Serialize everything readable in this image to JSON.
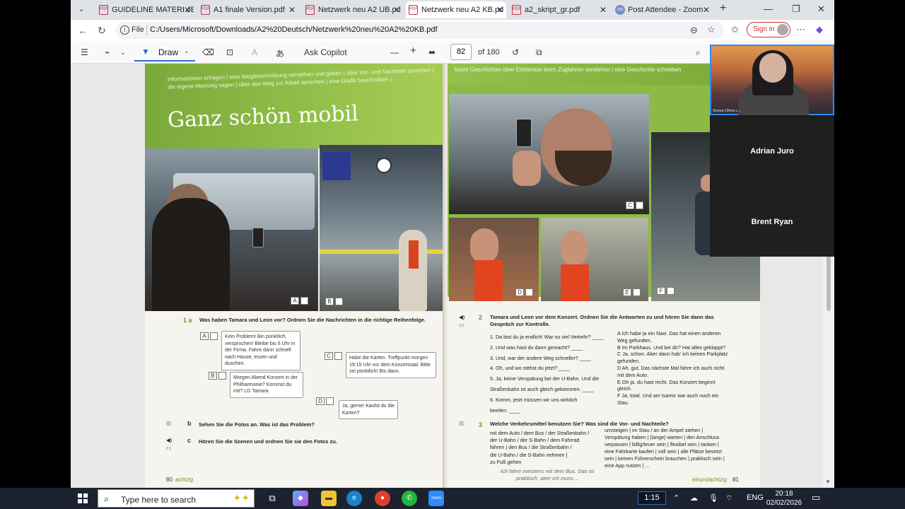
{
  "browser": {
    "tabs": [
      {
        "label": "GUIDELINE MATERI JER",
        "icon": "pdf-icon"
      },
      {
        "label": "A1 finale Version.pdf",
        "icon": "pdf-icon"
      },
      {
        "label": "Netzwerk neu A2 UB.pd",
        "icon": "pdf-icon"
      },
      {
        "label": "Netzwerk neu A2 KB.pd",
        "icon": "pdf-icon",
        "active": true
      },
      {
        "label": "a2_skript_gr.pdf",
        "icon": "pdf-icon"
      },
      {
        "label": "Post Attendee - Zoom",
        "icon": "zoom-icon"
      }
    ],
    "new_tab": "+",
    "address": {
      "scheme_label": "File",
      "url": "C:/Users/Microsoft/Downloads/A2%20Deutsch/Netzwerk%20neu%20A2%20KB.pdf"
    },
    "sign_in": "Sign in"
  },
  "pdf_toolbar": {
    "draw_label": "Draw",
    "copilot_label": "Ask Copilot",
    "page_current": "82",
    "page_total": "of 180"
  },
  "book_left": {
    "header_lines": [
      "Informationen erfragen  |  eine Wegbeschreibung verstehen und geben  |  über Vor- und Nachteile sprechen  |",
      "die eigene Meinung sagen  |  über den Weg zur Arbeit sprechen  |  eine Grafik beschreiben  |"
    ],
    "title": "Ganz schön mobil",
    "photo_labels": [
      "A",
      "B"
    ],
    "ex1a_num": "1 a",
    "ex1a_text": "Was haben Tamara und Leon vor? Ordnen Sie die Nachrichten in die richtige Reihenfolge.",
    "msgs": [
      {
        "letter": "A",
        "text": "Kein Problem! Bin pünktlich, versprochen! Bleibe bis 6 Uhr in der Firma. Fahre dann schnell nach Hause, essen und duschen."
      },
      {
        "letter": "B",
        "text": "Morgen Abend Konzert in der Philharmonie? Kommst du mit? LG Tamara"
      },
      {
        "letter": "C",
        "text": "Habe die Karten. Treffpunkt morgen 19:15 Uhr vor dem Konzertsaal. Bitte sei pünktlich! Bis dann."
      },
      {
        "letter": "D",
        "text": "Ja, gerne! Kaufst du die Karten?"
      }
    ],
    "ex1b_num": "b",
    "ex1b_text": "Sehen Sie die Fotos an. Was ist das Problem?",
    "ex1c_num": "c",
    "ex1c_text": "Hören Sie die Szenen und ordnen Sie sie den Fotos zu.",
    "track_1c": "2.1",
    "page_no": "80",
    "page_word": "achtzig"
  },
  "book_right": {
    "header": "kurze Geschichten über Erlebnisse beim Zugfahren verstehen  |  eine Geschichte schreiben",
    "photo_labels": [
      "C",
      "D",
      "E",
      "F"
    ],
    "ex2_num": "2",
    "ex2_track": "2.2",
    "ex2_text": "Tamara und Leon vor dem Konzert. Ordnen Sie die Antworten zu und hören Sie dann das Gespräch zur Kontrolle.",
    "questions": [
      "1.  Da bist du ja endlich! War so viel Verkehr? ____",
      "2.  Und was hast du dann gemacht? ____",
      "3.  Und, war der andere Weg schneller? ____",
      "4.  Oh, und wo stehst du jetzt? ____",
      "5.  Ja, keine Verspätung bei der U-Bahn. Und die",
      "     Straßenbahn ist auch gleich gekommen. ____",
      "6.  Komm, jetzt müssen wir uns wirklich",
      "     beeilen. ____"
    ],
    "answers": [
      "A  Ich habe ja ein Navi. Das hat einen anderen",
      "     Weg gefunden.",
      "B  Im Parkhaus. Und bei dir? Hat alles geklappt?",
      "C  Ja, schon. Aber dann hab' ich keinen Parkplatz",
      "     gefunden.",
      "D  Ah, gut. Das nächste Mal fahre ich auch nicht",
      "     mit dem Auto.",
      "E  Oh ja, du hast recht. Das Konzert beginnt",
      "     gleich.",
      "F  Ja, total. Und am Isartor war auch noch ein",
      "     Stau."
    ],
    "ex3_num": "3",
    "ex3_text": "Welche Verkehrsmittel benutzen Sie? Was sind die Vor- und Nachteile?",
    "ex3_left": [
      "mit dem Auto / dem Bus / der Straßenbahn /",
      "der U-Bahn / der S-Bahn / dem Fahrrad",
      "fahren  |  den Bus / die Straßenbahn /",
      "die U-Bahn / die S-Bahn nehmen  |",
      "zu Fuß gehen"
    ],
    "ex3_right": [
      "umsteigen  |  im Stau / an der Ampel stehen  |",
      "Verspätung haben  |  (lange) warten  |  den Anschluss",
      "verpassen  |  billig/teuer sein  |  flexibel sein  |  tanken  |",
      "eine Fahrkarte kaufen  |  voll sein  |  alle Plätze besetzt",
      "sein  |  keinen Führerschein brauchen  |  praktisch sein  |",
      "eine App nutzen  |  ..."
    ],
    "example": "Ich fahre meistens mit dem Bus. Das ist",
    "example2": "praktisch, aber ich muss ...",
    "page_word": "einundachtzig",
    "page_no": "81"
  },
  "zoom": {
    "self_name": "Sonya Olivia L...",
    "participants": [
      "Adrian Juro",
      "Brent Ryan"
    ]
  },
  "taskbar": {
    "search_placeholder": "Type here to search",
    "video_time": "1:15",
    "lang": "ENG",
    "time": "20:18",
    "date": "02/02/2026"
  }
}
